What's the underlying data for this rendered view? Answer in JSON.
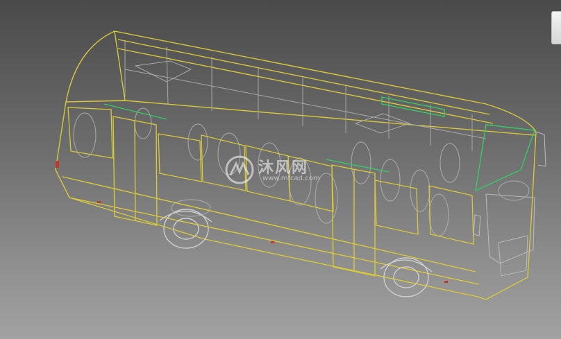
{
  "viewport": {
    "background_top": "#4a4a4a",
    "background_bottom": "#a2a2a2",
    "wireframe_yellow": "#d8c93a",
    "wireframe_green": "#33cc66",
    "wireframe_gray": "#9a9a9a"
  },
  "model": {
    "subject": "city-bus wireframe model",
    "icons": [
      "viewcube-icon",
      "watermark-logo-icon"
    ]
  },
  "watermark": {
    "text_cn": "沐风网",
    "text_en": "www.mfcad.com"
  }
}
